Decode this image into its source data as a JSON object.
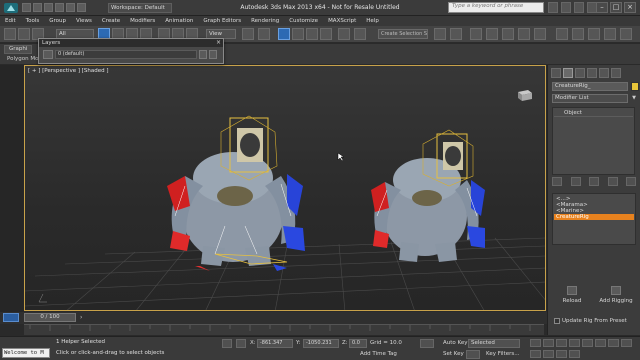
{
  "title_bar": {
    "title": "Autodesk 3ds Max  2013 x64  - Not for Resale   Untitled",
    "workspace": "Workspace: Default",
    "search_placeholder": "Type a keyword or phrase"
  },
  "menu": [
    "Edit",
    "Tools",
    "Group",
    "Views",
    "Create",
    "Modifiers",
    "Animation",
    "Graph Editors",
    "Rendering",
    "Customize",
    "MAXScript",
    "Help"
  ],
  "toolbar": {
    "selection_filter": "All",
    "reference_coord": "View",
    "named_selection_placeholder": "Create Selection S"
  },
  "ribbon": {
    "tab_graphite": "Graphi",
    "sub_label": "Polygon Mo"
  },
  "layers_window": {
    "title": "Layers",
    "current_layer": "0 (default)"
  },
  "viewport": {
    "label": "[ + ] [Perspective ] [Shaded ]",
    "accent_color": "#c8a24a"
  },
  "command_panel": {
    "object_name": "CreatureRig_",
    "modifier_list": "Modifier List",
    "stack_items": [
      "Object"
    ],
    "rig_list": [
      "<...>",
      "<Marama>",
      "<Marine>",
      "CreatureRig"
    ],
    "selected_rig": "CreatureRig",
    "reload_label": "Reload",
    "add_rigging_label": "Add Rigging",
    "update_label": "Update Rig From Preset",
    "selection_color": "#e8821e"
  },
  "timeline": {
    "frame": "0 / 100"
  },
  "status_bar": {
    "maxscript": "Welcome to M",
    "selection": "1 Helper Selected",
    "prompt": "Click or click-and-drag to select objects",
    "x_label": "X:",
    "x_value": "-861.347",
    "y_label": "Y:",
    "y_value": "-1050.231",
    "z_label": "Z:",
    "z_value": "0.0",
    "grid": "Grid = 10.0",
    "add_time_tag": "Add Time Tag",
    "auto_key": "Auto Key",
    "auto_key_value": "Selected",
    "set_key": "Set Key",
    "key_filters": "Key Filters..."
  }
}
